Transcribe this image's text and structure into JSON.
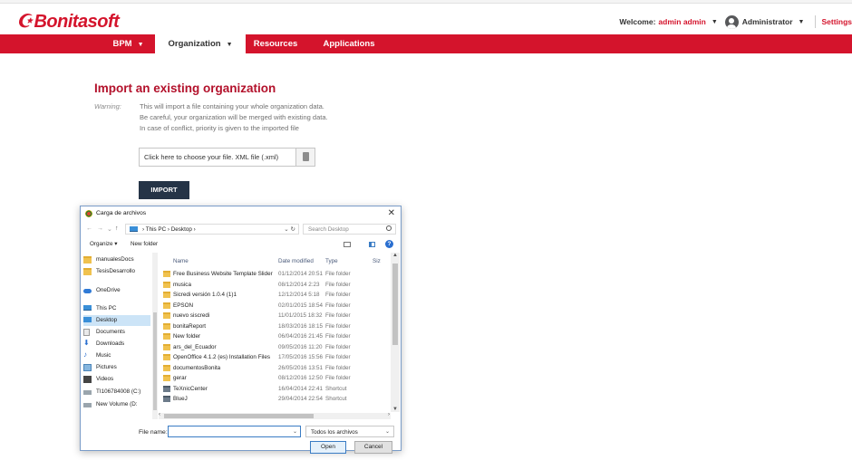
{
  "header": {
    "logo": "Bonitasoft",
    "welcome_label": "Welcome:",
    "username": "admin admin",
    "role": "Administrator",
    "settings": "Settings"
  },
  "nav": {
    "items": [
      {
        "label": "BPM"
      },
      {
        "label": "Organization"
      },
      {
        "label": "Resources"
      },
      {
        "label": "Applications"
      }
    ]
  },
  "main": {
    "title": "Import an existing organization",
    "warning_label": "Warning:",
    "warning_lines": [
      "This will import a file containing your whole organization data.",
      "Be careful, your organization will be merged with existing data.",
      "In case of conflict, priority is given to the imported file"
    ],
    "file_placeholder": "Click here to choose your file. XML file (.xml)",
    "import_button": "IMPORT"
  },
  "dialog": {
    "title": "Carga de archivos",
    "path": "› This PC › Desktop ›",
    "search_placeholder": "Search Desktop",
    "organize": "Organize ▾",
    "new_folder": "New folder",
    "nav_items": [
      {
        "label": "manualesDocs",
        "icon": "folder-icon"
      },
      {
        "label": "TesisDesarrollo",
        "icon": "folder-icon"
      },
      {
        "label": "OneDrive",
        "icon": "cloud-icon"
      },
      {
        "label": "This PC",
        "icon": "pc-icon"
      },
      {
        "label": "Desktop",
        "icon": "desktop-icon",
        "selected": true
      },
      {
        "label": "Documents",
        "icon": "document-icon"
      },
      {
        "label": "Downloads",
        "icon": "download-icon"
      },
      {
        "label": "Music",
        "icon": "music-icon"
      },
      {
        "label": "Pictures",
        "icon": "pictures-icon"
      },
      {
        "label": "Videos",
        "icon": "video-icon"
      },
      {
        "label": "TI106784008 (C:)",
        "icon": "drive-icon"
      },
      {
        "label": "New Volume (D:",
        "icon": "drive-icon"
      }
    ],
    "columns": [
      "Name",
      "Date modified",
      "Type",
      "Siz"
    ],
    "files": [
      {
        "name": "Free Business Website Template Slider",
        "date": "01/12/2014 20:51",
        "type": "File folder",
        "kind": "folder"
      },
      {
        "name": "musica",
        "date": "08/12/2014 2:23",
        "type": "File folder",
        "kind": "folder"
      },
      {
        "name": "Sicredi versión 1.0.4 (1)1",
        "date": "12/12/2014 5:18",
        "type": "File folder",
        "kind": "folder"
      },
      {
        "name": "EPSON",
        "date": "02/01/2015 18:54",
        "type": "File folder",
        "kind": "folder"
      },
      {
        "name": "nuevo siscredi",
        "date": "11/01/2015 18:32",
        "type": "File folder",
        "kind": "folder"
      },
      {
        "name": "bonitaReport",
        "date": "18/03/2016 18:15",
        "type": "File folder",
        "kind": "folder"
      },
      {
        "name": "New folder",
        "date": "06/04/2016 21:45",
        "type": "File folder",
        "kind": "folder"
      },
      {
        "name": "ars_del_Ecuador",
        "date": "09/05/2016 11:20",
        "type": "File folder",
        "kind": "folder"
      },
      {
        "name": "OpenOffice 4.1.2 (es) Installation Files",
        "date": "17/05/2016 15:56",
        "type": "File folder",
        "kind": "folder"
      },
      {
        "name": "documentosBonita",
        "date": "26/05/2016 13:51",
        "type": "File folder",
        "kind": "folder"
      },
      {
        "name": "gerar",
        "date": "08/12/2016 12:50",
        "type": "File folder",
        "kind": "folder"
      },
      {
        "name": "TeXnicCenter",
        "date": "16/04/2014 22:41",
        "type": "Shortcut",
        "kind": "shortcut"
      },
      {
        "name": "BlueJ",
        "date": "29/04/2014 22:54",
        "type": "Shortcut",
        "kind": "shortcut"
      }
    ],
    "file_name_label": "File name:",
    "file_name_value": "",
    "file_type": "Todos los archivos",
    "open_button": "Open",
    "cancel_button": "Cancel"
  },
  "colors": {
    "brand_red": "#d4142c",
    "title_red": "#b3112b",
    "import_button": "#253447"
  }
}
